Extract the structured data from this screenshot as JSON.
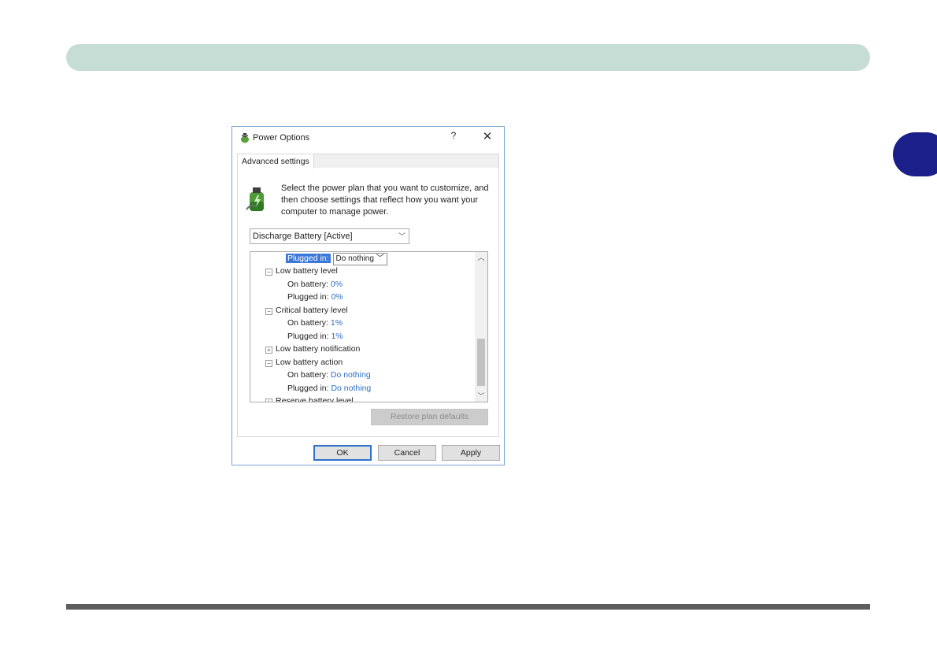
{
  "dialog": {
    "title": "Power Options",
    "help": "?",
    "close": "✕",
    "tab": "Advanced settings",
    "intro": "Select the power plan that you want to customize, and then choose settings that reflect how you want your computer to manage power.",
    "plan": "Discharge Battery [Active]"
  },
  "tree": {
    "top_label": "Plugged in:",
    "top_value": "Do nothing",
    "low_level": {
      "label": "Low battery level",
      "on_label": "On battery:",
      "on_value": "0%",
      "plug_label": "Plugged in:",
      "plug_value": "0%"
    },
    "critical_level": {
      "label": "Critical battery level",
      "on_label": "On battery:",
      "on_value": "1%",
      "plug_label": "Plugged in:",
      "plug_value": "1%"
    },
    "low_notification": {
      "label": "Low battery notification"
    },
    "low_action": {
      "label": "Low battery action",
      "on_label": "On battery:",
      "on_value": "Do nothing",
      "plug_label": "Plugged in:",
      "plug_value": "Do nothing"
    },
    "reserve": {
      "label": "Reserve battery level"
    }
  },
  "buttons": {
    "restore": "Restore plan defaults",
    "ok": "OK",
    "cancel": "Cancel",
    "apply": "Apply"
  }
}
